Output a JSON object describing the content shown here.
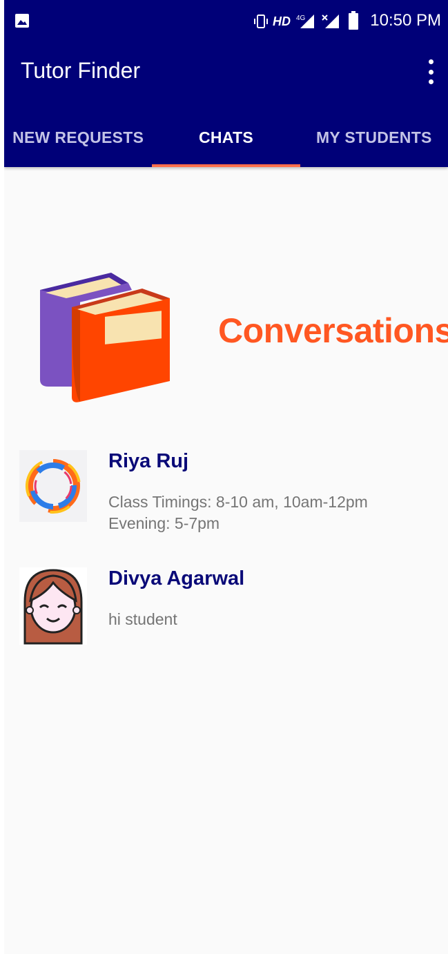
{
  "status_bar": {
    "network": "HD",
    "network_type": "4G",
    "time": "10:50 PM",
    "icons": [
      "image-icon",
      "vibrate-icon",
      "signal-icon",
      "no-signal-icon",
      "battery-icon"
    ]
  },
  "toolbar": {
    "title": "Tutor Finder",
    "menu_icon": "more-vert-icon"
  },
  "tabs": [
    {
      "label": "NEW REQUESTS",
      "active": false
    },
    {
      "label": "CHATS",
      "active": true
    },
    {
      "label": "MY STUDENTS",
      "active": false
    }
  ],
  "hero": {
    "title": "Conversations",
    "icon": "books-icon"
  },
  "chats": [
    {
      "name": "Riya Ruj",
      "message": "Class Timings: 8-10 am, 10am-12pm\nEvening: 5-7pm",
      "avatar": "swirl-avatar"
    },
    {
      "name": "Divya Agarwal",
      "message": "hi student",
      "avatar": "girl-avatar"
    }
  ],
  "colors": {
    "primary": "#000078",
    "accent": "#ff5722",
    "tab_indicator": "#ff6f4b",
    "name_text": "#0a0a78",
    "message_text": "#757575",
    "background": "#fafafa"
  }
}
